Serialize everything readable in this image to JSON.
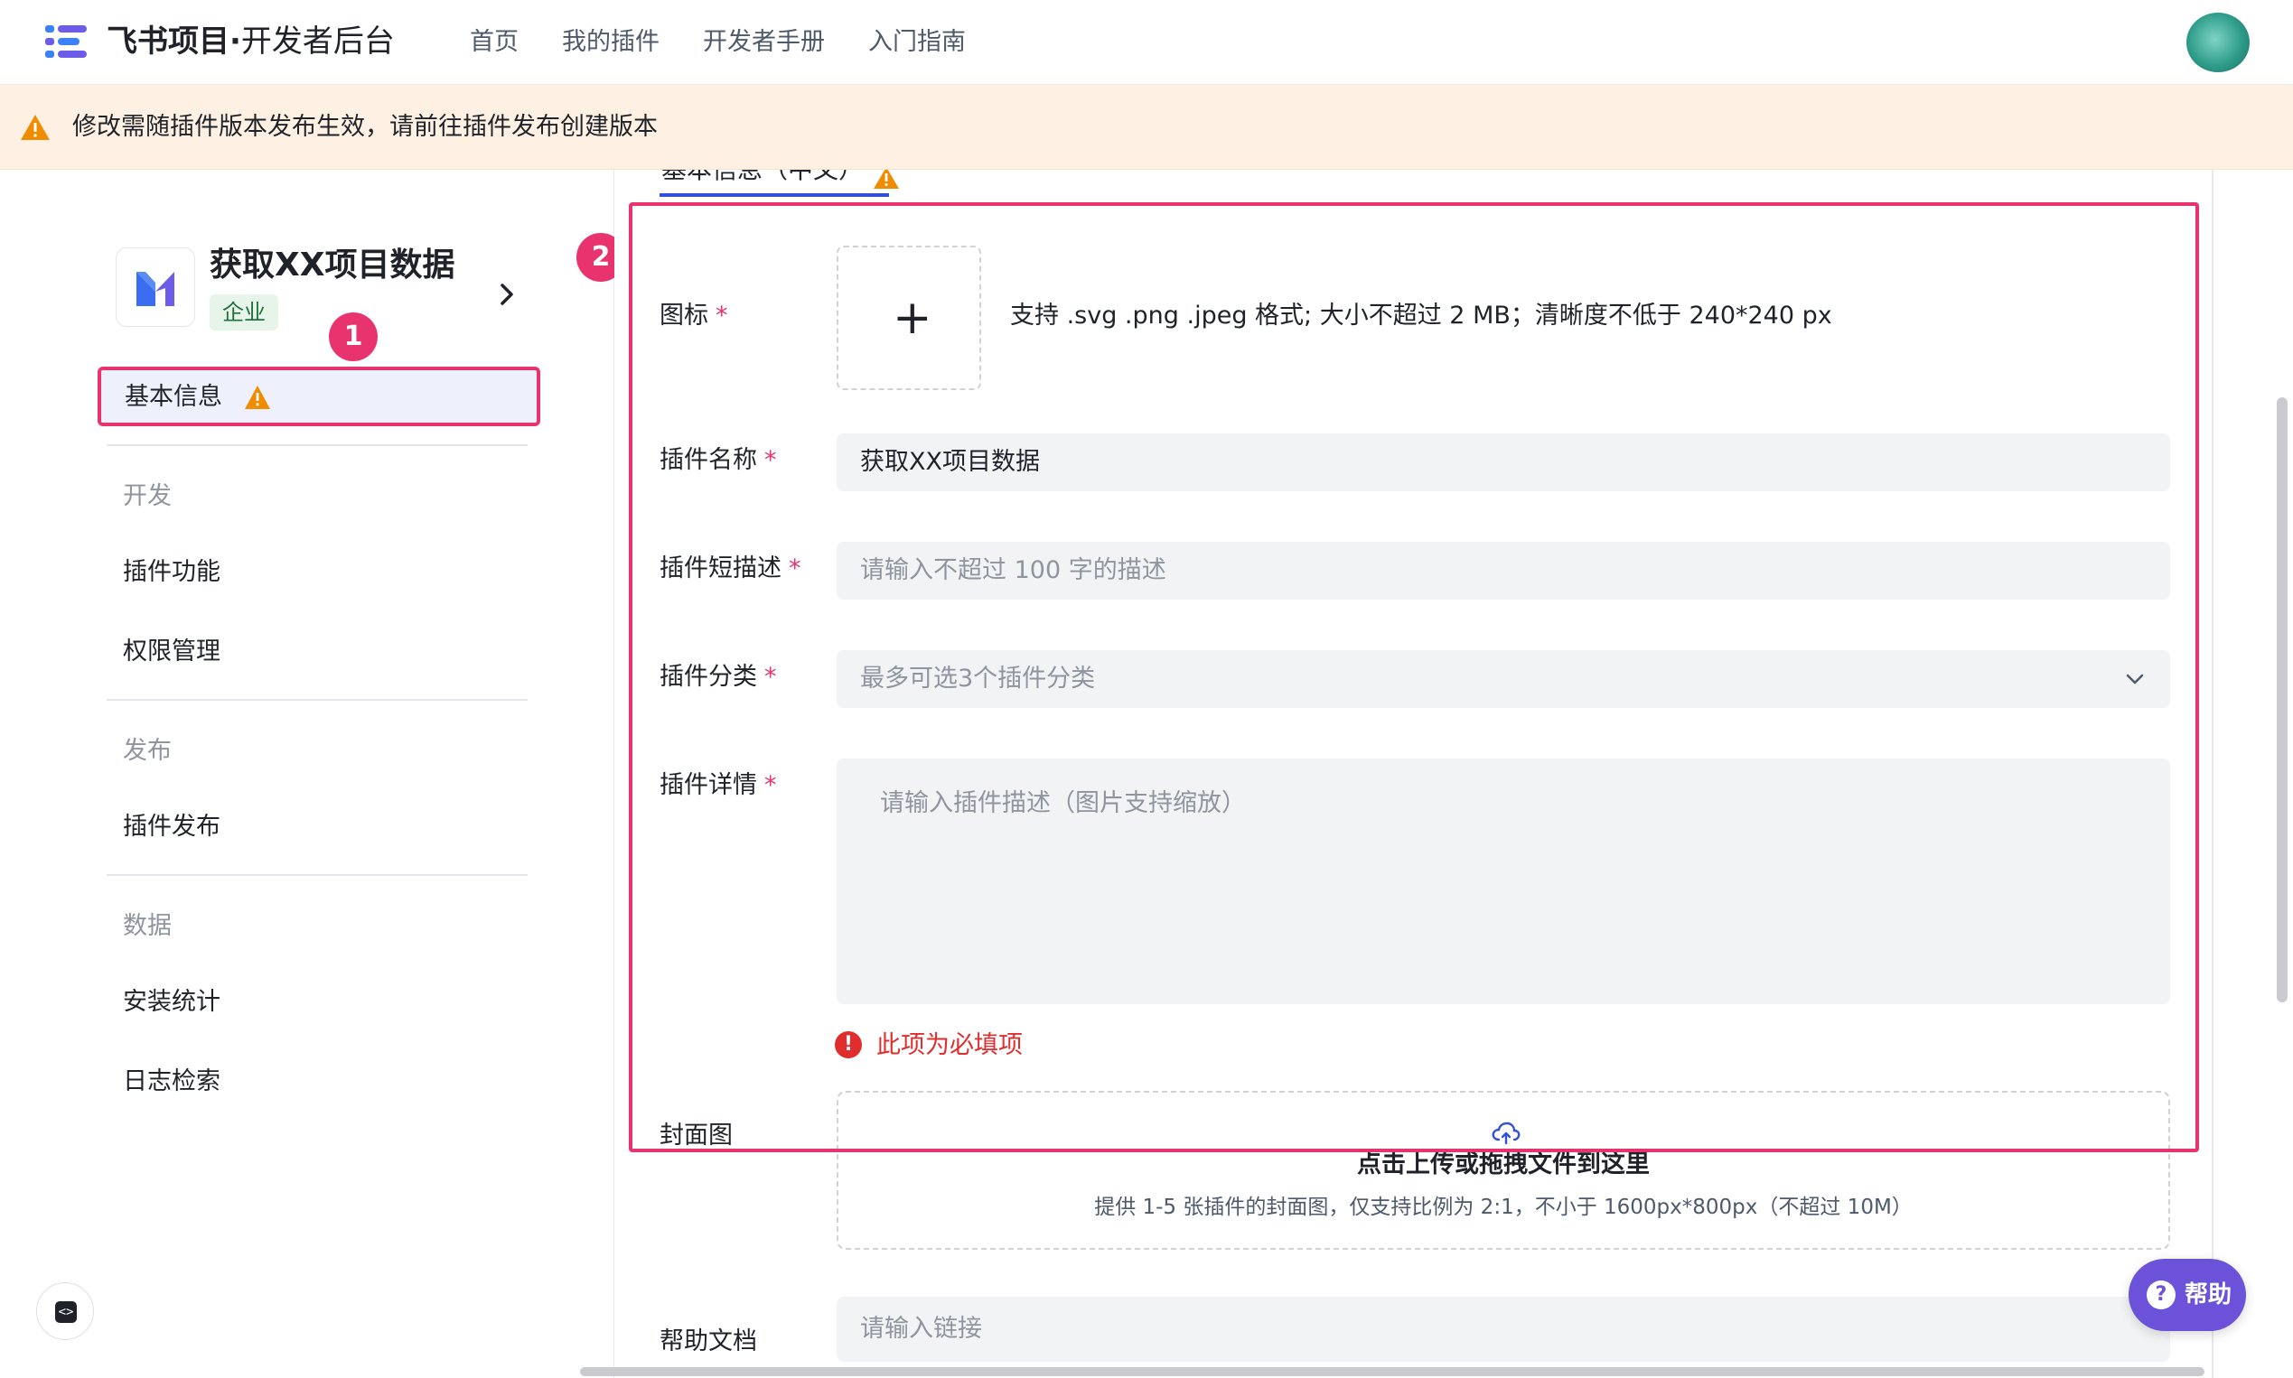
{
  "header": {
    "brand_main": "飞书项目·",
    "brand_sub": "开发者后台",
    "nav": [
      "首页",
      "我的插件",
      "开发者手册",
      "入门指南"
    ]
  },
  "banner": {
    "text": "修改需随插件版本发布生效，请前往插件发布创建版本"
  },
  "sidebar": {
    "plugin_name": "获取XX项目数据",
    "plugin_tag": "企业",
    "active_item": "基本信息",
    "sections": [
      {
        "title": "开发",
        "items": [
          "插件功能",
          "权限管理"
        ]
      },
      {
        "title": "发布",
        "items": [
          "插件发布"
        ]
      },
      {
        "title": "数据",
        "items": [
          "安装统计",
          "日志检索"
        ]
      }
    ]
  },
  "markers": [
    "1",
    "2"
  ],
  "main": {
    "tab_label": "基本信息（中文）",
    "required_mark": "*",
    "icon_field": {
      "label": "图标",
      "hint": "支持 .svg .png .jpeg 格式; 大小不超过 2 MB；清晰度不低于 240*240 px"
    },
    "name_field": {
      "label": "插件名称",
      "value": "获取XX项目数据"
    },
    "short_desc_field": {
      "label": "插件短描述",
      "placeholder": "请输入不超过 100 字的描述"
    },
    "category_field": {
      "label": "插件分类",
      "placeholder": "最多可选3个插件分类"
    },
    "detail_field": {
      "label": "插件详情",
      "placeholder": "请输入插件描述（图片支持缩放）",
      "error": "此项为必填项"
    },
    "cover_field": {
      "label": "封面图",
      "upload_title": "点击上传或拖拽文件到这里",
      "upload_hint": "提供 1-5 张插件的封面图，仅支持比例为 2:1，不小于 1600px*800px（不超过 10M）"
    },
    "help_doc_field": {
      "label": "帮助文档",
      "placeholder": "请输入链接"
    }
  },
  "help_button": {
    "label": "帮助"
  },
  "colors": {
    "accent": "#e8336e",
    "primary": "#3250d8",
    "warning": "#f08c00",
    "error": "#e02d2d"
  }
}
